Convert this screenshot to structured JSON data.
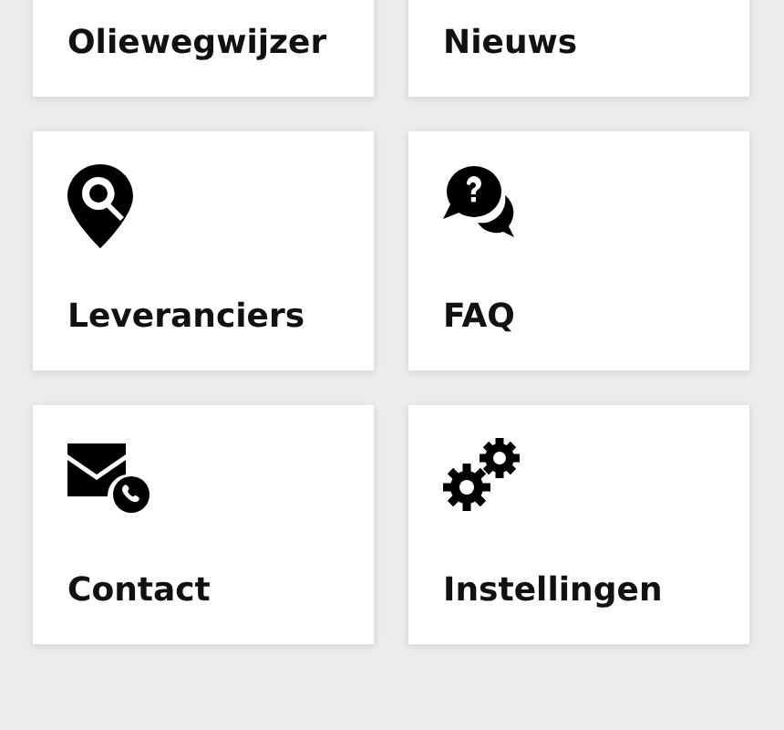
{
  "tiles": [
    {
      "label": "Oliewegwijzer"
    },
    {
      "label": "Nieuws"
    },
    {
      "label": "Leveranciers"
    },
    {
      "label": "FAQ"
    },
    {
      "label": "Contact"
    },
    {
      "label": "Instellingen"
    }
  ]
}
